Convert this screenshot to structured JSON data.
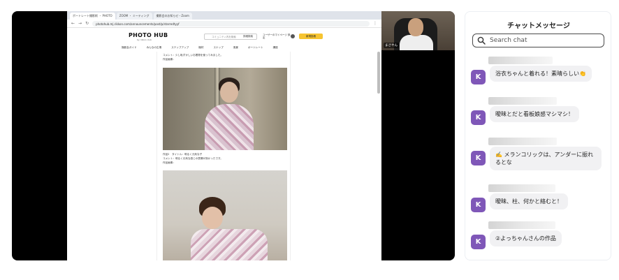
{
  "browser": {
    "tabs": [
      "ポートレート撮影術 ・ PHOTO",
      "ZOOM ・ ミーティング",
      "撮影会のお知らせ・Zoom"
    ],
    "url": "photohub.mj.rikkon.com/announcements/post/p/starredtyyf"
  },
  "site": {
    "logo": "PHOTO HUB",
    "logo_sub": "by rikkon club",
    "search_placeholder": "コミュニティ内を検索",
    "search_button": "詳細検索",
    "user_label": "ユーザーのマイページ 設定",
    "post_button": "新規投稿",
    "nav": [
      "撮影会ガイド",
      "みんなの広場",
      "ステップアップ",
      "機材",
      "スナップ",
      "風景",
      "ポートレート",
      "講座"
    ]
  },
  "article": {
    "comment1": "コメント：少し恥ずかしいお着物を使ってみました。",
    "label1": "作品画像：",
    "title2": "作品2　タイトル：明るく元気な子",
    "comment2": "コメント：明るく元気な感じの表情が良かったです。",
    "label2": "作品画像："
  },
  "speaker": {
    "name": "まさやん"
  },
  "chat": {
    "title": "チャットメッセージ",
    "search_placeholder": "Search chat",
    "messages": [
      {
        "initial": "K",
        "text": "浴衣ちゃんと着れる！素晴らしい👏"
      },
      {
        "initial": "K",
        "text": "曖昧とだと看板娘感マシマシ！"
      },
      {
        "initial": "K",
        "text": "✍️ メランコリックは、アンダーに振れるとな"
      },
      {
        "initial": "K",
        "text": "曖昧、柱、何かと絡むと！"
      },
      {
        "initial": "K",
        "text": "②よっちゃんさんの作品"
      }
    ]
  },
  "colors": {
    "avatar": "#7f57b8",
    "bubble": "#f1f1f3",
    "post_button": "#f6c431"
  }
}
